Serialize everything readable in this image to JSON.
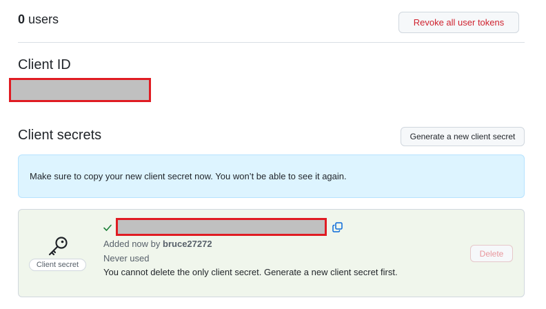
{
  "users": {
    "count": "0",
    "label": "users"
  },
  "buttons": {
    "revoke_all": "Revoke all user tokens",
    "generate_secret": "Generate a new client secret",
    "delete": "Delete"
  },
  "client_id": {
    "heading": "Client ID"
  },
  "client_secrets": {
    "heading": "Client secrets",
    "flash_message": "Make sure to copy your new client secret now. You won’t be able to see it again.",
    "secret": {
      "badge": "Client secret",
      "added_prefix": "Added now by",
      "added_by": "bruce27272",
      "usage": "Never used",
      "delete_note": "You cannot delete the only client secret. Generate a new client secret first."
    }
  },
  "colors": {
    "danger": "#cf222e",
    "flash_bg": "#ddf4ff",
    "secret_bg": "#f0f6ec",
    "redaction_border": "#e01b22",
    "redaction_fill": "#c0c0c0",
    "link_blue": "#0969da",
    "success": "#1a7f37"
  },
  "icons": {
    "key": "key-icon",
    "check": "check-icon",
    "copy": "copy-icon"
  }
}
